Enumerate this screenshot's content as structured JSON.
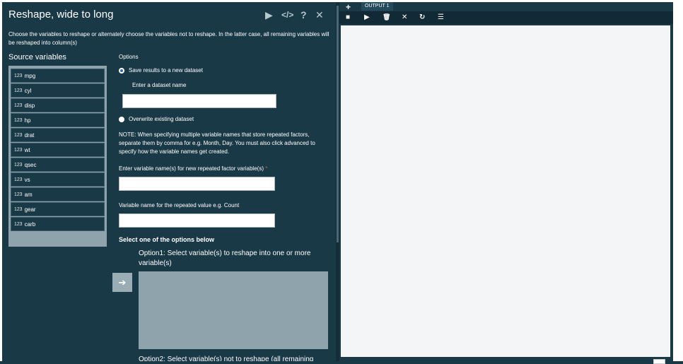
{
  "dialog": {
    "title": "Reshape, wide to long",
    "toolbar": {
      "run_icon": "▶",
      "code_icon": "</>",
      "help_icon": "?",
      "close_icon": "✕"
    },
    "description": "Choose the variables to reshape or alternately choose the variables not to reshape. In the latter case, all remaining variables will be reshaped into column(s)",
    "source_label": "Source variables",
    "source_variables": [
      "mpg",
      "cyl",
      "disp",
      "hp",
      "drat",
      "wt",
      "qsec",
      "vs",
      "am",
      "gear",
      "carb"
    ],
    "variable_icon_text": "1 2 3",
    "options": {
      "heading": "Options",
      "save_new_label": "Save results to a new dataset",
      "dataset_name_label": "Enter a dataset name",
      "dataset_name_value": "",
      "overwrite_label": "Overwrite existing dataset",
      "note": "NOTE: When specifying multiple variable names that store repeated factors, separate them by comma for e.g. Month, Day. You must also click advanced to specify how the variable names get created.",
      "factor_label": "Enter variable name(s) for new repeated factor variable(s)",
      "required_mark": "*",
      "factor_value": "",
      "repeated_value_label": "Variable name for the repeated value e.g. Count",
      "repeated_value_value": "",
      "select_heading": "Select one of the options below",
      "option1_label": "Option1: Select variable(s) to reshape into one or more variable(s)",
      "option2_label": "Option2: Select variable(s) not to reshape (all remaining",
      "move_icon": "➔"
    }
  },
  "output": {
    "add_tab_icon": "+",
    "tab_label": "OUTPUT 1",
    "toolbar_icons": [
      "■",
      "▶",
      "🗑",
      "✕",
      "↻",
      "☰"
    ]
  },
  "colors": {
    "panel_bg": "#1a3947",
    "list_bg": "#8fa3ac",
    "output_bg": "#f4f5f6"
  }
}
